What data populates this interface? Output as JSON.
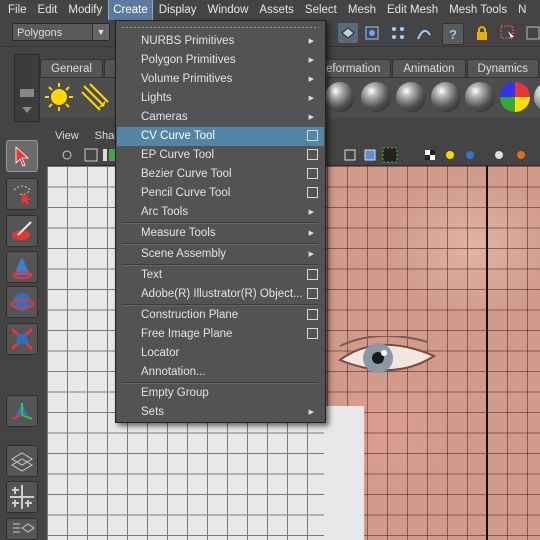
{
  "menubar": [
    "File",
    "Edit",
    "Modify",
    "Create",
    "Display",
    "Window",
    "Assets",
    "Select",
    "Mesh",
    "Edit Mesh",
    "Mesh Tools",
    "N"
  ],
  "active_menu_index": 3,
  "mode_select": {
    "value": "Polygons"
  },
  "shelf_tabs": [
    "General",
    "Deformation",
    "Animation",
    "Dynamics"
  ],
  "panel_menu": [
    "View",
    "Shad"
  ],
  "create_menu": {
    "items": [
      {
        "label": "NURBS Primitives",
        "submenu": true
      },
      {
        "label": "Polygon Primitives",
        "submenu": true
      },
      {
        "label": "Volume Primitives",
        "submenu": true
      },
      {
        "label": "Lights",
        "submenu": true
      },
      {
        "label": "Cameras",
        "submenu": true
      },
      {
        "label": "CV Curve Tool",
        "option_box": true,
        "highlighted": true
      },
      {
        "label": "EP Curve Tool",
        "option_box": true
      },
      {
        "label": "Bezier Curve Tool",
        "option_box": true
      },
      {
        "label": "Pencil Curve Tool",
        "option_box": true
      },
      {
        "label": "Arc Tools",
        "submenu": true
      },
      {
        "label": "Measure Tools",
        "submenu": true
      },
      {
        "label": "Scene Assembly",
        "submenu": true
      },
      {
        "label": "Text",
        "option_box": true
      },
      {
        "label": "Adobe(R) Illustrator(R) Object...",
        "option_box": true
      },
      {
        "label": "Construction Plane",
        "option_box": true
      },
      {
        "label": "Free Image Plane",
        "option_box": true
      },
      {
        "label": "Locator"
      },
      {
        "label": "Annotation..."
      },
      {
        "label": "Empty Group"
      },
      {
        "label": "Sets",
        "submenu": true
      }
    ]
  },
  "colors": {
    "menu_highlight": "#5285a6",
    "menu_bg": "#535353",
    "ui_bg": "#444444"
  }
}
